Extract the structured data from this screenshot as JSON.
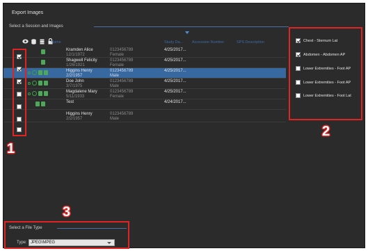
{
  "window": {
    "title": "Export Images"
  },
  "session_section": {
    "label": "Select a Session and Images"
  },
  "columns": {
    "name": "Name",
    "study_date": "Study Da...",
    "accession": "Accession Number",
    "sps": "SPS Description"
  },
  "patients": [
    {
      "name": "Kramden Alice",
      "dob": "12/1/1972",
      "id": "0123456789",
      "sex": "Female",
      "study_date": "4/25/2017...",
      "checked": true
    },
    {
      "name": "Shagwell Felicity",
      "dob": "1/26/1921",
      "id": "0123456789",
      "sex": "Female",
      "study_date": "4/25/2017...",
      "checked": true
    },
    {
      "name": "Higgins Henry",
      "dob": "2/2/1957",
      "id": "0123456789",
      "sex": "Male",
      "study_date": "4/25/2017...",
      "checked": true,
      "selected": true
    },
    {
      "name": "Doe John",
      "dob": "3/7/1975",
      "id": "0123456789",
      "sex": "Male",
      "study_date": "4/25/2017...",
      "checked": false
    },
    {
      "name": "Magdalene Mary",
      "dob": "5/11/1933",
      "id": "0123456789",
      "sex": "Female",
      "study_date": "4/25/2017...",
      "checked": false
    },
    {
      "name": "Test",
      "dob": "",
      "id": "",
      "sex": "",
      "study_date": "4/24/2017...",
      "checked": false
    },
    {
      "name": "Higgins Henry",
      "dob": "2/2/1957",
      "id": "0123456789",
      "sex": "Male",
      "study_date": "",
      "checked": false
    }
  ],
  "images": [
    {
      "label": "Chest - Sternum Lat",
      "checked": true
    },
    {
      "label": "Abdomen - Abdomen AP",
      "checked": true
    },
    {
      "label": "Lower Extremities - Foot AP",
      "checked": false
    },
    {
      "label": "Lower Extremities - Foot AP",
      "checked": false
    },
    {
      "label": "Lower Extremities - Foot Lat",
      "checked": false
    }
  ],
  "file_type": {
    "section_label": "Select a File Type",
    "type_label": "Type:",
    "selected": "JPEG\\MPEG"
  },
  "callouts": {
    "one": "1",
    "two": "2",
    "three": "3"
  },
  "colors": {
    "background": "#2b2b2b",
    "selection": "#37689f",
    "accent": "#3d6aa6",
    "status": "#3aa34a",
    "callout": "#e02424"
  },
  "icons": [
    "eye-icon",
    "disk-icon",
    "stack-icon",
    "lock-icon",
    "chevron-down-icon",
    "checkbox-icon",
    "status-dot-icon"
  ]
}
